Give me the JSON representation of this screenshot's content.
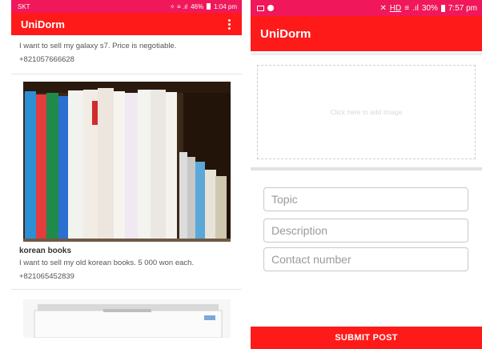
{
  "left_phone": {
    "status": {
      "carrier": "SKT",
      "icons": "✧ ≡ .ıl",
      "battery": "46%",
      "time": "1:04 pm"
    },
    "app_title": "UniDorm",
    "posts": [
      {
        "description": "I want to sell my galaxy s7. Price is negotiable.",
        "contact": "+821057666628"
      },
      {
        "title": "korean books",
        "description": "I want to sell my old korean books. 5 000 won each.",
        "contact": "+821065452839",
        "image": "korean-books-photo"
      },
      {
        "image": "freezer-photo"
      }
    ]
  },
  "right_phone": {
    "status": {
      "signal_text": "HD",
      "battery": "30%",
      "time": "7:57 pm"
    },
    "app_title": "UniDorm",
    "image_placeholder": "Click here to add Image",
    "form": {
      "topic_placeholder": "Topic",
      "description_placeholder": "Description",
      "contact_placeholder": "Contact number"
    },
    "submit_label": "SUBMIT POST"
  },
  "colors": {
    "status_bar": "#f0185a",
    "app_bar": "#ff1a1a",
    "submit": "#ff1a1a"
  }
}
